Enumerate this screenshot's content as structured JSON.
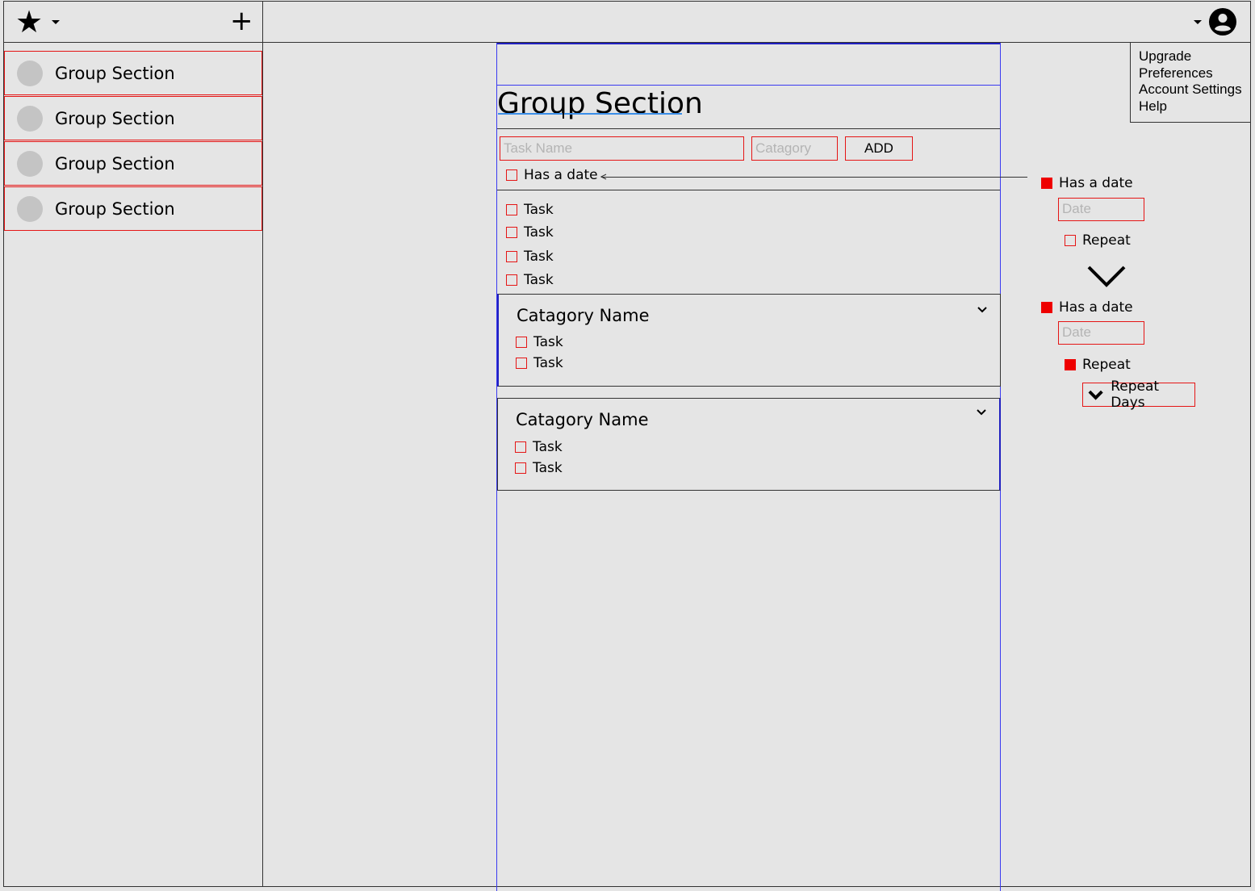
{
  "header": {
    "logo_icon": "star-icon",
    "add_icon": "plus-icon",
    "account_icon": "account-circle-icon"
  },
  "sidebar": {
    "items": [
      {
        "label": "Group Section"
      },
      {
        "label": "Group Section"
      },
      {
        "label": "Group Section"
      },
      {
        "label": "Group Section"
      }
    ]
  },
  "main": {
    "title": "Group Section",
    "task_name_placeholder": "Task Name",
    "category_placeholder": "Catagory",
    "add_label": "ADD",
    "has_date_label": "Has a date",
    "tasks": [
      {
        "label": "Task"
      },
      {
        "label": "Task"
      },
      {
        "label": "Task"
      },
      {
        "label": "Task"
      }
    ],
    "categories": [
      {
        "name": "Catagory Name",
        "tasks": [
          {
            "label": "Task"
          },
          {
            "label": "Task"
          }
        ]
      },
      {
        "name": "Catagory Name",
        "tasks": [
          {
            "label": "Task"
          },
          {
            "label": "Task"
          }
        ]
      }
    ]
  },
  "date_panel": {
    "state_a": {
      "has_date_label": "Has a date",
      "has_date_checked": true,
      "date_placeholder": "Date",
      "repeat_label": "Repeat",
      "repeat_checked": false
    },
    "state_b": {
      "has_date_label": "Has a date",
      "has_date_checked": true,
      "date_placeholder": "Date",
      "repeat_label": "Repeat",
      "repeat_checked": true,
      "repeat_days_label": "Repeat Days"
    }
  },
  "user_menu": {
    "items": [
      {
        "label": "Upgrade"
      },
      {
        "label": "Preferences"
      },
      {
        "label": "Account Settings"
      },
      {
        "label": "Help"
      }
    ]
  },
  "colors": {
    "background": "#e5e5e5",
    "accent_red": "#e51515",
    "accent_blue": "#3a3af0",
    "title_underline": "#3b8ee8",
    "avatar_gray": "#c4c4c4"
  }
}
